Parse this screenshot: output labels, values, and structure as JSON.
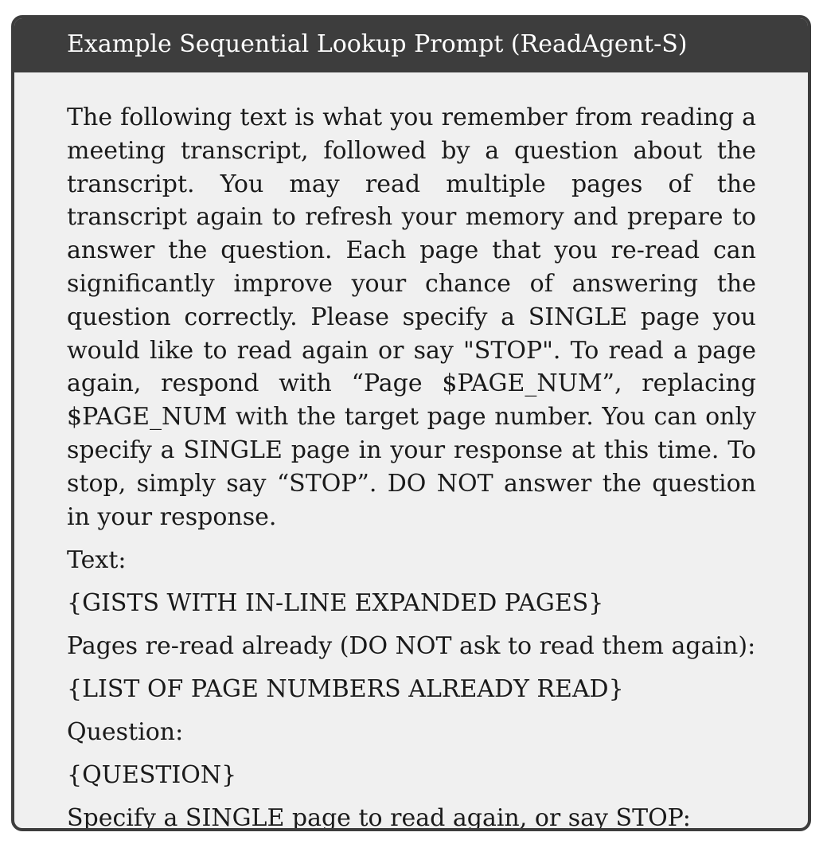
{
  "box": {
    "title": "Example Sequential Lookup Prompt (ReadAgent-S)",
    "instructions": "The following text is what you remember from reading a meeting transcript, followed by a question about the transcript. You may read multiple pages of the transcript again to refresh your memory and prepare to answer the question. Each page that you re-read can significantly im­prove your chance of answering the question correctly. Please specify a SINGLE page you would like to read again or say \"STOP\". To read a page again, respond with “Page $PAGE_NUM”, replacing $PAGE_NUM with the tar­get page number. You can only specify a SINGLE page in your response at this time. To stop, simply say “STOP”. DO NOT answer the question in your response.",
    "text_label": "Text:",
    "gists_placeholder": "{GISTS WITH IN-LINE EXPANDED PAGES}",
    "pages_read_label": "Pages re-read already (DO NOT ask to read them again):",
    "pages_read_placeholder": "{LIST OF PAGE NUMBERS ALREADY READ}",
    "question_label": "Question:",
    "question_placeholder": "{QUESTION}",
    "final_instruction": "Specify a SINGLE page to read again, or say STOP:"
  },
  "colors": {
    "frame": "#3d3d3d",
    "background": "#f0f0f0",
    "title_text": "#ffffff",
    "body_text": "#1a1a1a"
  }
}
